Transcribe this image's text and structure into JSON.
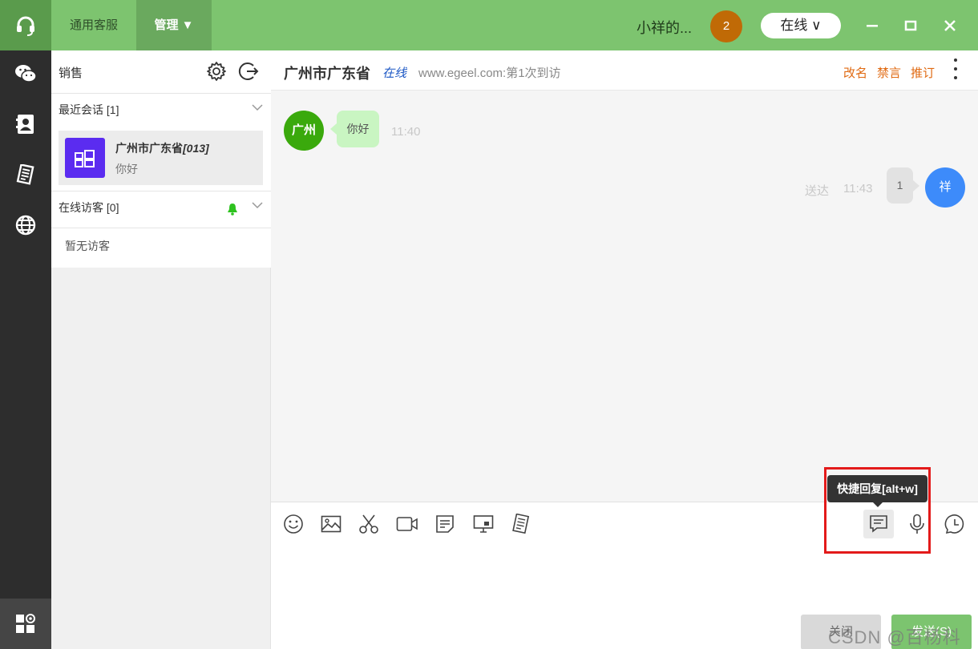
{
  "topbar": {
    "tab_general": "通用客服",
    "tab_manage": "管理 ▼",
    "user_name": "小祥的...",
    "badge_count": "2",
    "status": "在线 ∨"
  },
  "panel": {
    "title": "销售",
    "recent_sessions": "最近会话 [1]",
    "session": {
      "name": "广州市广东省",
      "code": "[013]",
      "last_message": "你好"
    },
    "online_visitors": "在线访客 [0]",
    "no_visitors": "暂无访客"
  },
  "chat": {
    "title": "广州市广东省",
    "online": "在线",
    "site": "www.egeel.com:第1次到访",
    "actions": {
      "rename": "改名",
      "mute": "禁言",
      "recommend": "推订"
    },
    "messages": {
      "incoming": {
        "avatar": "广州",
        "text": "你好",
        "time": "11:40"
      },
      "outgoing": {
        "avatar": "祥",
        "text": "1",
        "status": "送达",
        "time": "11:43"
      }
    }
  },
  "input": {
    "tooltip": "快捷回复[alt+w]",
    "close": "关闭",
    "send": "发送(S)",
    "watermark": "CSDN @百杨科技"
  },
  "colors": {
    "brand_green": "#7dc46f",
    "rail_dark": "#2d2d2d",
    "badge_orange": "#c06a06",
    "action_orange": "#e06a12",
    "visitor_avatar_green": "#3aa90c",
    "agent_avatar_blue": "#3d8bfa",
    "highlight_red": "#e31a1a"
  }
}
